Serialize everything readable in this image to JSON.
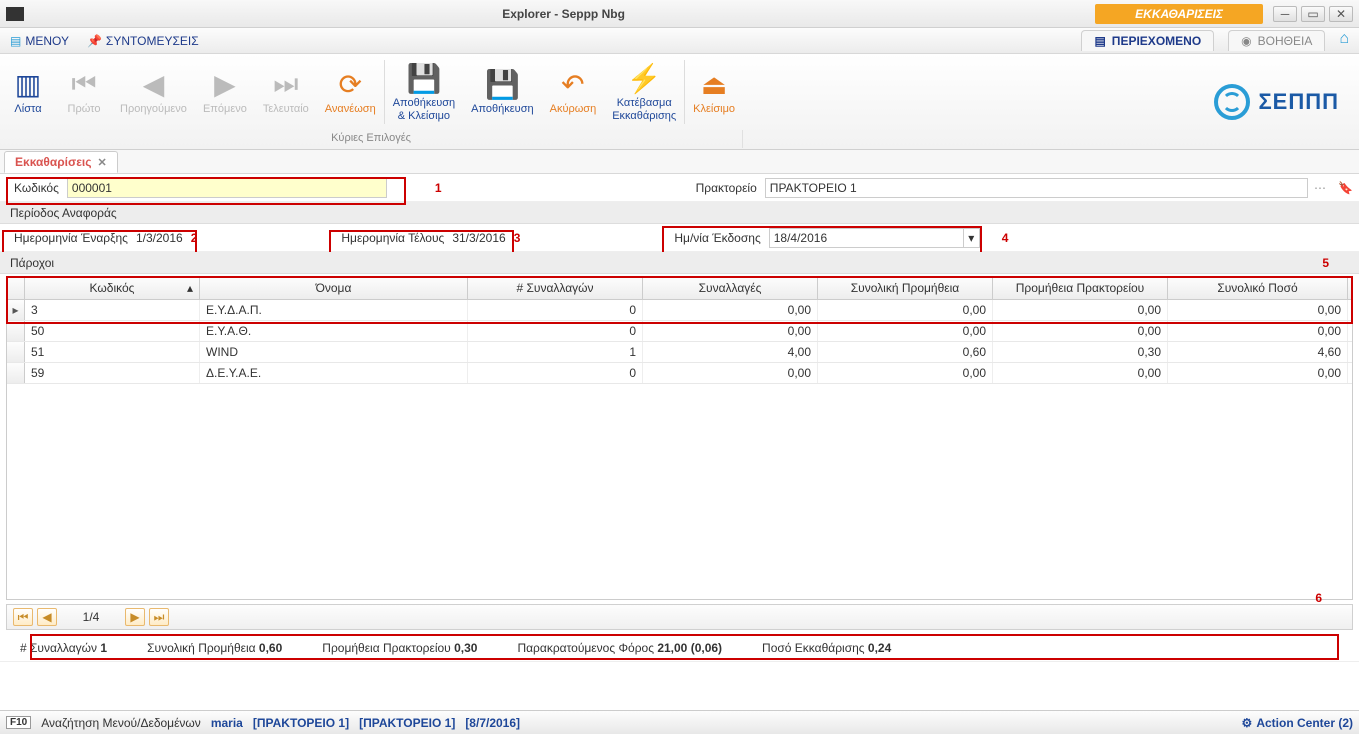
{
  "title": "Explorer - Seppp Nbg",
  "banner": "ΕΚΚΑΘΑΡΙΣΕΙΣ",
  "menubar": {
    "menu": "ΜΕΝΟΥ",
    "shortcuts": "ΣΥΝΤΟΜΕΥΣΕΙΣ",
    "content": "ΠΕΡΙΕΧΟΜΕΝΟ",
    "help": "ΒΟΗΘΕΙΑ"
  },
  "ribbon": {
    "list": "Λίστα",
    "first": "Πρώτο",
    "prev": "Προηγούμενο",
    "next": "Επόμενο",
    "last": "Τελευταίο",
    "refresh": "Ανανέωση",
    "saveclose": "Αποθήκευση\n& Κλείσιμο",
    "save": "Αποθήκευση",
    "cancel": "Ακύρωση",
    "download": "Κατέβασμα\nΕκκαθάρισης",
    "close": "Κλείσιμο",
    "caption": "Κύριες Επιλογές"
  },
  "brand": "ΣΕΠΠΠ",
  "tab": {
    "title": "Εκκαθαρίσεις"
  },
  "form": {
    "code_label": "Κωδικός",
    "code_value": "000001",
    "agency_label": "Πρακτορείο",
    "agency_value": "ΠΡΑΚΤΟΡΕΙΟ 1",
    "period_section": "Περίοδος Αναφοράς",
    "start_label": "Ημερομηνία Έναρξης",
    "start_value": "1/3/2016",
    "end_label": "Ημερομηνία Τέλους",
    "end_value": "31/3/2016",
    "issue_label": "Ημ/νία Έκδοσης",
    "issue_value": "18/4/2016",
    "providers_section": "Πάροχοι"
  },
  "anno": {
    "a1": "1",
    "a2": "2",
    "a3": "3",
    "a4": "4",
    "a5": "5",
    "a6": "6"
  },
  "grid": {
    "headers": {
      "code": "Κωδικός",
      "name": "Όνομα",
      "transcount": "# Συναλλαγών",
      "trans": "Συναλλαγές",
      "comm": "Συνολική Προμήθεια",
      "acomm": "Προμήθεια Πρακτορείου",
      "total": "Συνολικό Ποσό"
    },
    "rows": [
      {
        "code": "3",
        "name": "Ε.Υ.Δ.Α.Π.",
        "transcount": "0",
        "trans": "0,00",
        "comm": "0,00",
        "acomm": "0,00",
        "total": "0,00"
      },
      {
        "code": "50",
        "name": "Ε.Υ.Α.Θ.",
        "transcount": "0",
        "trans": "0,00",
        "comm": "0,00",
        "acomm": "0,00",
        "total": "0,00"
      },
      {
        "code": "51",
        "name": "WIND",
        "transcount": "1",
        "trans": "4,00",
        "comm": "0,60",
        "acomm": "0,30",
        "total": "4,60"
      },
      {
        "code": "59",
        "name": "Δ.Ε.Υ.Α.Ε.",
        "transcount": "0",
        "trans": "0,00",
        "comm": "0,00",
        "acomm": "0,00",
        "total": "0,00"
      }
    ]
  },
  "pager": {
    "pos": "1/4"
  },
  "totals": {
    "transcount_label": "# Συναλλαγών",
    "transcount": "1",
    "comm_label": "Συνολική Προμήθεια",
    "comm": "0,60",
    "acomm_label": "Προμήθεια Πρακτορείου",
    "acomm": "0,30",
    "tax_label": "Παρακρατούμενος Φόρος",
    "tax": "21,00 (0,06)",
    "amount_label": "Ποσό Εκκαθάρισης",
    "amount": "0,24"
  },
  "status": {
    "fkey": "F10",
    "search": "Αναζήτηση Μενού/Δεδομένων",
    "user": "maria",
    "agency1": "[ΠΡΑΚΤΟΡΕΙΟ 1]",
    "agency2": "[ΠΡΑΚΤΟΡΕΙΟ 1]",
    "date": "[8/7/2016]",
    "action_center": "Action Center (2)"
  }
}
